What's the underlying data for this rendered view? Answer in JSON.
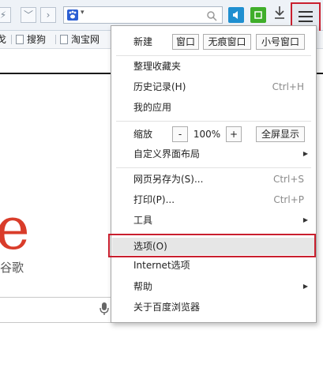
{
  "toolbar": {
    "back_glyph": "⚡",
    "down_glyph": "﹀",
    "forward_glyph": "›",
    "engine_caret": "▾",
    "search_glass": "⚲",
    "ext1_glyph": "◀",
    "ext2_glyph": "◻",
    "download_glyph": "⤓",
    "colors": {
      "ext1": "#1f8fd0",
      "ext2": "#3fae2a",
      "menu_highlight": "#c91f2e"
    }
  },
  "bookmarks": {
    "partial_first": "戈",
    "items": [
      "搜狗",
      "淘宝网"
    ]
  },
  "page": {
    "logo_letter": "e",
    "logo_sub": "谷歌",
    "mic": "🎤"
  },
  "menu": {
    "new_label": "新建",
    "new_buttons": [
      "窗口",
      "无痕窗口",
      "小号窗口"
    ],
    "items_group1": [
      {
        "label": "整理收藏夹",
        "shortcut": ""
      },
      {
        "label": "历史记录(H)",
        "shortcut": "Ctrl+H"
      },
      {
        "label": "我的应用",
        "shortcut": ""
      }
    ],
    "zoom": {
      "label": "缩放",
      "minus": "-",
      "value": "100%",
      "plus": "+",
      "fullscreen": "全屏显示"
    },
    "customize_label": "自定义界面布局",
    "items_group2": [
      {
        "label": "网页另存为(S)...",
        "shortcut": "Ctrl+S"
      },
      {
        "label": "打印(P)...",
        "shortcut": "Ctrl+P"
      },
      {
        "label": "工具",
        "shortcut": ""
      }
    ],
    "items_group3": [
      {
        "label": "选项(O)"
      },
      {
        "label": "Internet选项"
      },
      {
        "label": "帮助"
      },
      {
        "label": "关于百度浏览器"
      }
    ],
    "submenu_arrow": "▶"
  }
}
